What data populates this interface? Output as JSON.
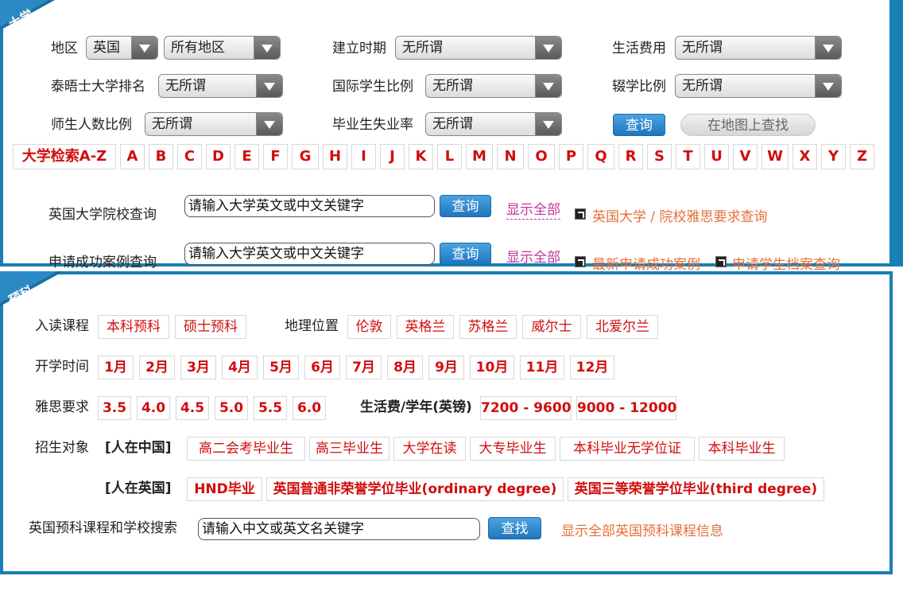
{
  "university": {
    "corner_label": "大学",
    "filters": {
      "region_label": "地区",
      "region_country": "英国",
      "region_area": "所有地区",
      "founded_label": "建立时期",
      "founded_value": "无所谓",
      "living_cost_label": "生活费用",
      "living_cost_value": "无所谓",
      "times_rank_label": "泰晤士大学排名",
      "times_rank_value": "无所谓",
      "intl_ratio_label": "国际学生比例",
      "intl_ratio_value": "无所谓",
      "dropout_label": "辍学比例",
      "dropout_value": "无所谓",
      "staff_ratio_label": "师生人数比例",
      "staff_ratio_value": "无所谓",
      "unemploy_label": "毕业生失业率",
      "unemploy_value": "无所谓",
      "query_button": "查询",
      "map_button": "在地图上查找"
    },
    "az_title": "大学检索A-Z",
    "letters": [
      "A",
      "B",
      "C",
      "D",
      "E",
      "F",
      "G",
      "H",
      "I",
      "J",
      "K",
      "L",
      "M",
      "N",
      "O",
      "P",
      "Q",
      "R",
      "S",
      "T",
      "U",
      "V",
      "W",
      "X",
      "Y",
      "Z"
    ],
    "school_search": {
      "label": "英国大学院校查询",
      "placeholder": "请输入大学英文或中文关键字",
      "button": "查询",
      "show_all": "显示全部",
      "link": "英国大学 / 院校雅思要求查询"
    },
    "case_search": {
      "label": "申请成功案例查询",
      "placeholder": "请输入大学英文或中文关键字",
      "button": "查询",
      "show_all": "显示全部",
      "link1": "最新申请成功案例",
      "link2": "申请学生档案查询"
    }
  },
  "foundation": {
    "corner_label": "预科",
    "course_label": "入读课程",
    "courses": [
      "本科预科",
      "硕士预科"
    ],
    "location_label": "地理位置",
    "locations": [
      "伦敦",
      "英格兰",
      "苏格兰",
      "威尔士",
      "北爱尔兰"
    ],
    "start_label": "开学时间",
    "months": [
      "1月",
      "2月",
      "3月",
      "4月",
      "5月",
      "6月",
      "7月",
      "8月",
      "9月",
      "10月",
      "11月",
      "12月"
    ],
    "ielts_label": "雅思要求",
    "ielts": [
      "3.5",
      "4.0",
      "4.5",
      "5.0",
      "5.5",
      "6.0"
    ],
    "cost_label": "生活费/学年(英镑)",
    "costs": [
      "7200 - 9600",
      "9000 - 12000"
    ],
    "target_label": "招生对象",
    "in_china_label": "[人在中国]",
    "in_china": [
      "高二会考毕业生",
      "高三毕业生",
      "大学在读",
      "大专毕业生",
      "本科毕业无学位证",
      "本科毕业生"
    ],
    "in_uk_label": "[人在英国]",
    "in_uk": [
      "HND毕业",
      "英国普通非荣誉学位毕业(ordinary degree)",
      "英国三等荣誉学位毕业(third degree)"
    ],
    "search_label": "英国预科课程和学校搜索",
    "search_placeholder": "请输入中文或英文名关键字",
    "search_button": "查找",
    "show_all_link": "显示全部英国预科课程信息"
  }
}
